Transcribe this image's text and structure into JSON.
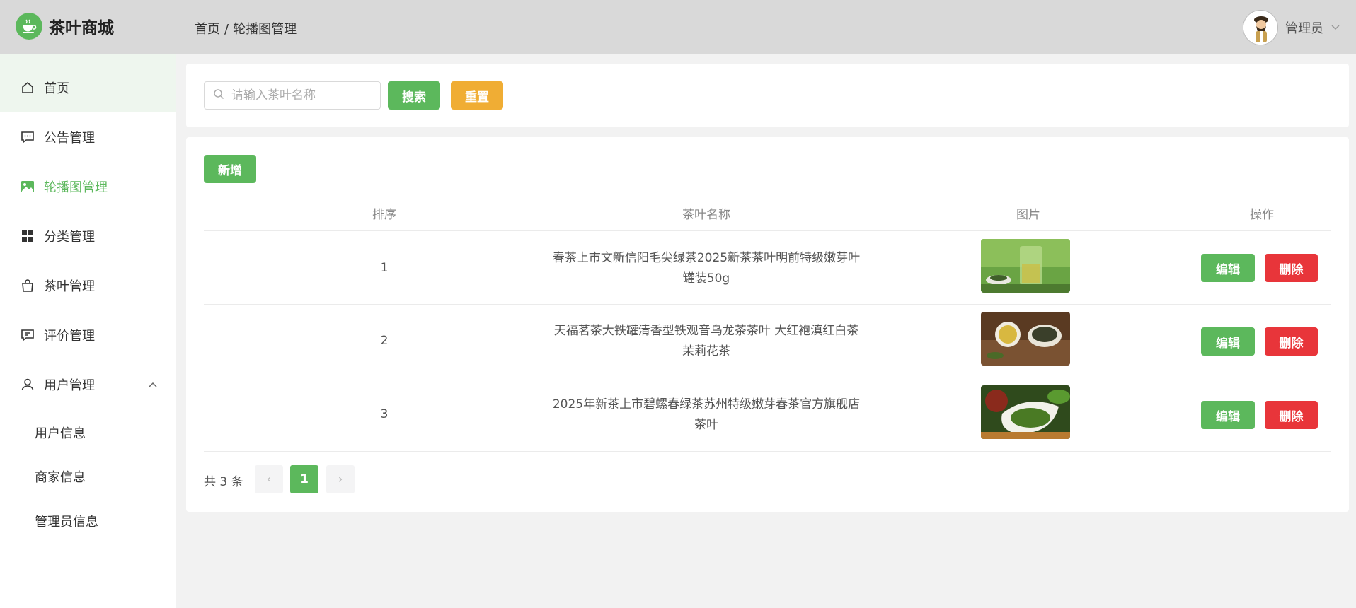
{
  "app": {
    "title": "茶叶商城",
    "breadcrumb": [
      "首页",
      "轮播图管理"
    ],
    "breadcrumb_sep": "/",
    "user_name": "管理员"
  },
  "sidebar": {
    "items": [
      {
        "label": "首页",
        "icon": "home-icon"
      },
      {
        "label": "公告管理",
        "icon": "message-icon"
      },
      {
        "label": "轮播图管理",
        "icon": "picture-icon"
      },
      {
        "label": "分类管理",
        "icon": "grid-icon"
      },
      {
        "label": "茶叶管理",
        "icon": "bag-icon"
      },
      {
        "label": "评价管理",
        "icon": "comment-icon"
      },
      {
        "label": "用户管理",
        "icon": "user-icon"
      }
    ],
    "sub_items": [
      "用户信息",
      "商家信息",
      "管理员信息"
    ]
  },
  "search": {
    "placeholder": "请输入茶叶名称",
    "search_label": "搜索",
    "reset_label": "重置"
  },
  "toolbar": {
    "add_label": "新增"
  },
  "table": {
    "headers": [
      "排序",
      "茶叶名称",
      "图片",
      "操作"
    ],
    "rows": [
      {
        "order": "1",
        "name": "春茶上市文新信阳毛尖绿茶2025新茶茶叶明前特级嫩芽叶罐装50g"
      },
      {
        "order": "2",
        "name": "天福茗茶大铁罐清香型铁观音乌龙茶茶叶 大红袍滇红白茶茉莉花茶"
      },
      {
        "order": "3",
        "name": "2025年新茶上市碧螺春绿茶苏州特级嫩芽春茶官方旗舰店茶叶"
      }
    ],
    "edit_label": "编辑",
    "delete_label": "删除"
  },
  "pagination": {
    "total_text": "共 3 条",
    "current_page": "1",
    "prev": "‹",
    "next": "›"
  },
  "colors": {
    "primary": "#5cb85c",
    "warning": "#f0ad34",
    "danger": "#e8353a"
  }
}
